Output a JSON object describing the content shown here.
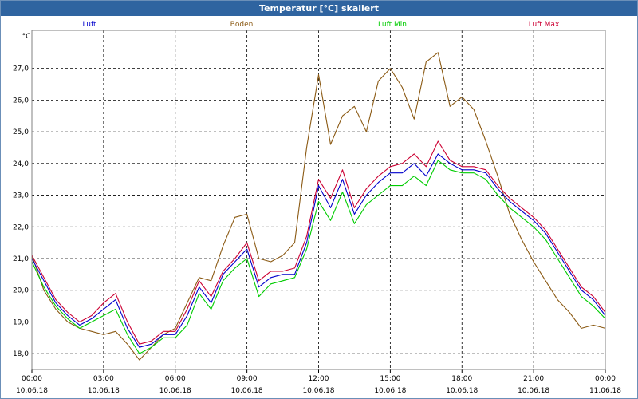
{
  "window": {
    "title": "Temperatur [°C] skaliert"
  },
  "chart_data": {
    "type": "line",
    "title": "Temperatur [°C] skaliert",
    "ylabel": "°C",
    "ylim": [
      17.5,
      28.2
    ],
    "xlim": [
      "2018-06-10 00:00",
      "2018-06-11 00:00"
    ],
    "grid": true,
    "legend_placement": "top",
    "y_ticks": [
      "18,0",
      "19,0",
      "20,0",
      "21,0",
      "22,0",
      "23,0",
      "24,0",
      "25,0",
      "26,0",
      "27,0"
    ],
    "y_tick_values": [
      18,
      19,
      20,
      21,
      22,
      23,
      24,
      25,
      26,
      27
    ],
    "x_tick_hours": [
      0,
      3,
      6,
      9,
      12,
      15,
      18,
      21,
      24
    ],
    "x_ticks": [
      {
        "time": "00:00",
        "date": "10.06.18"
      },
      {
        "time": "03:00",
        "date": "10.06.18"
      },
      {
        "time": "06:00",
        "date": "10.06.18"
      },
      {
        "time": "09:00",
        "date": "10.06.18"
      },
      {
        "time": "12:00",
        "date": "10.06.18"
      },
      {
        "time": "15:00",
        "date": "10.06.18"
      },
      {
        "time": "18:00",
        "date": "10.06.18"
      },
      {
        "time": "21:00",
        "date": "10.06.18"
      },
      {
        "time": "00:00",
        "date": "11.06.18"
      }
    ],
    "x_hours": [
      0,
      0.5,
      1,
      1.5,
      2,
      2.5,
      3,
      3.5,
      4,
      4.5,
      5,
      5.5,
      6,
      6.5,
      7,
      7.5,
      8,
      8.5,
      9,
      9.5,
      10,
      10.5,
      11,
      11.5,
      12,
      12.5,
      13,
      13.5,
      14,
      14.5,
      15,
      15.5,
      16,
      16.5,
      17,
      17.5,
      18,
      18.5,
      19,
      19.5,
      20,
      20.5,
      21,
      21.5,
      22,
      22.5,
      23,
      23.5,
      24
    ],
    "series": [
      {
        "name": "Luft",
        "color": "#0000cc",
        "values": [
          21.0,
          20.3,
          19.6,
          19.2,
          18.9,
          19.1,
          19.4,
          19.7,
          18.8,
          18.2,
          18.3,
          18.6,
          18.6,
          19.2,
          20.1,
          19.6,
          20.5,
          20.9,
          21.3,
          20.1,
          20.4,
          20.5,
          20.5,
          21.5,
          23.3,
          22.6,
          23.5,
          22.4,
          23.0,
          23.4,
          23.7,
          23.7,
          24.0,
          23.6,
          24.3,
          24.0,
          23.8,
          23.8,
          23.7,
          23.2,
          22.8,
          22.5,
          22.2,
          21.8,
          21.2,
          20.6,
          20.0,
          19.7,
          19.2
        ]
      },
      {
        "name": "Boden",
        "color": "#8b5a14",
        "values": [
          21.1,
          20.0,
          19.4,
          19.0,
          18.8,
          18.7,
          18.6,
          18.7,
          18.3,
          17.8,
          18.2,
          18.6,
          18.8,
          19.6,
          20.4,
          20.3,
          21.4,
          22.3,
          22.4,
          21.0,
          20.9,
          21.1,
          21.5,
          24.5,
          26.8,
          24.6,
          25.5,
          25.8,
          25.0,
          26.6,
          27.0,
          26.4,
          25.4,
          27.2,
          27.5,
          25.8,
          26.1,
          25.7,
          24.7,
          23.6,
          22.4,
          21.6,
          20.9,
          20.3,
          19.7,
          19.3,
          18.8,
          18.9,
          18.8
        ]
      },
      {
        "name": "Luft Min",
        "color": "#00cc00",
        "values": [
          20.9,
          20.1,
          19.5,
          19.1,
          18.8,
          19.0,
          19.2,
          19.4,
          18.6,
          18.0,
          18.2,
          18.5,
          18.5,
          18.9,
          19.9,
          19.4,
          20.3,
          20.7,
          21.0,
          19.8,
          20.2,
          20.3,
          20.4,
          21.3,
          22.8,
          22.2,
          23.1,
          22.1,
          22.7,
          23.0,
          23.3,
          23.3,
          23.6,
          23.3,
          24.1,
          23.8,
          23.7,
          23.7,
          23.5,
          23.0,
          22.6,
          22.3,
          22.0,
          21.6,
          21.0,
          20.4,
          19.8,
          19.5,
          19.1
        ]
      },
      {
        "name": "Luft Max",
        "color": "#cc0033",
        "values": [
          21.1,
          20.4,
          19.7,
          19.3,
          19.0,
          19.2,
          19.6,
          19.9,
          19.0,
          18.3,
          18.4,
          18.7,
          18.7,
          19.4,
          20.3,
          19.8,
          20.6,
          21.0,
          21.5,
          20.3,
          20.6,
          20.6,
          20.7,
          21.7,
          23.5,
          22.9,
          23.8,
          22.6,
          23.2,
          23.6,
          23.9,
          24.0,
          24.3,
          23.9,
          24.7,
          24.1,
          23.9,
          23.9,
          23.8,
          23.3,
          22.9,
          22.6,
          22.3,
          21.9,
          21.3,
          20.7,
          20.1,
          19.8,
          19.3
        ]
      }
    ]
  }
}
